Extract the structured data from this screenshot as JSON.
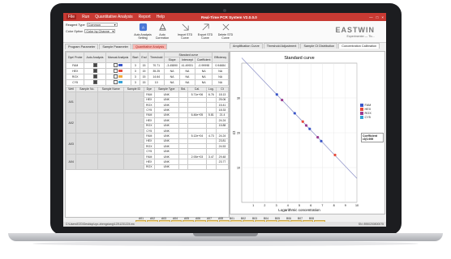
{
  "app": {
    "title": "Real-Time PCR System V2.0.0.0",
    "menu": [
      "File",
      "Run",
      "Quantitative Analysis",
      "Report",
      "Help"
    ],
    "window_controls": [
      "—",
      "□",
      "×"
    ]
  },
  "toolbar": {
    "reagent_type_label": "Reagent Type",
    "reagent_type_value": "Common",
    "color_option_label": "Color Option",
    "color_option_value": "Color by Channe",
    "tools": [
      {
        "label": "Auto Analysis Setting",
        "icon": "auto-analysis-icon"
      },
      {
        "label": "Auto Correction",
        "icon": "auto-correction-icon"
      },
      {
        "label": "Import STD Curve",
        "icon": "import-curve-icon"
      },
      {
        "label": "Export STD Curve",
        "icon": "export-curve-icon"
      },
      {
        "label": "Delete STD Curve",
        "icon": "delete-curve-icon"
      }
    ],
    "brand": "EASTWIN",
    "user": "Experimenter — Tic..."
  },
  "left_tabs": [
    "Program Parameter",
    "Sample Parameter",
    "Quantitative Analysis"
  ],
  "left_tab_active": 2,
  "right_tabs": [
    "Amplification Curve",
    "Threshold Adjustment",
    "Sample Ct Distribution",
    "Concentration Calibration"
  ],
  "right_tab_selected": 3,
  "dye_table": {
    "headers": [
      "Dye/ Probe",
      "Auto Analysis",
      "Manual Analysis",
      "Start",
      "End",
      "Threshold",
      "Slope",
      "Intercept",
      "Coefficient",
      "Efficiency"
    ],
    "group_header": "Standard curve",
    "rows": [
      {
        "dye": "FAM",
        "auto": true,
        "manual": false,
        "start": "3",
        "end": "15",
        "threshold": "70.71",
        "slope": "-3.45890",
        "intercept": "41.49931",
        "coef": "-0.99998",
        "eff": "0.94684",
        "color": "#3a56c9"
      },
      {
        "dye": "HEX",
        "auto": true,
        "manual": false,
        "start": "3",
        "end": "15",
        "threshold": "35.25",
        "slope": "NA",
        "intercept": "NA",
        "coef": "NA",
        "eff": "NA",
        "color": "#e84b3c"
      },
      {
        "dye": "ROX",
        "auto": true,
        "manual": false,
        "start": "3",
        "end": "15",
        "threshold": "14.64",
        "slope": "NA",
        "intercept": "NA",
        "coef": "NA",
        "eff": "NA",
        "color": "#f1a93b"
      },
      {
        "dye": "CY5",
        "auto": true,
        "manual": false,
        "start": "3",
        "end": "15",
        "threshold": "10",
        "slope": "NA",
        "intercept": "NA",
        "coef": "NA",
        "eff": "NA",
        "color": "#36a3d6"
      }
    ]
  },
  "well_table": {
    "headers": [
      "Well",
      "Sample No.",
      "Sample Name",
      "Sample ID",
      "Dye",
      "Sample Type",
      "Std.",
      "Cal.",
      "Log.",
      "Ct"
    ],
    "groups": [
      {
        "well": "A01",
        "rows": [
          {
            "dye": "FAM",
            "type": "UNK",
            "std": "",
            "cal": "5.71e+06",
            "log": "6.76",
            "ct": "18.13"
          },
          {
            "dye": "HEX",
            "type": "UNK",
            "std": "",
            "cal": "",
            "log": "",
            "ct": "25.06"
          },
          {
            "dye": "ROX",
            "type": "UNK",
            "std": "",
            "cal": "",
            "log": "",
            "ct": "15.41"
          },
          {
            "dye": "CY5",
            "type": "UNK",
            "std": "",
            "cal": "",
            "log": "",
            "ct": "18.33"
          }
        ]
      },
      {
        "well": "A02",
        "rows": [
          {
            "dye": "FAM",
            "type": "UNK",
            "std": "",
            "cal": "6.46e+05",
            "log": "5.81",
            "ct": "21.4"
          },
          {
            "dye": "HEX",
            "type": "UNK",
            "std": "",
            "cal": "",
            "log": "",
            "ct": "24.24"
          },
          {
            "dye": "ROX",
            "type": "UNK",
            "std": "",
            "cal": "",
            "log": "",
            "ct": "15.88"
          },
          {
            "dye": "CY5",
            "type": "UNK",
            "std": "",
            "cal": "",
            "log": "",
            "ct": ""
          }
        ]
      },
      {
        "well": "A03",
        "rows": [
          {
            "dye": "FAM",
            "type": "UNK",
            "std": "",
            "cal": "5.12e+04",
            "log": "4.73",
            "ct": "24.24"
          },
          {
            "dye": "HEX",
            "type": "UNK",
            "std": "",
            "cal": "",
            "log": "",
            "ct": "23.81"
          },
          {
            "dye": "ROX",
            "type": "UNK",
            "std": "",
            "cal": "",
            "log": "",
            "ct": "24.53"
          },
          {
            "dye": "CY5",
            "type": "UNK",
            "std": "",
            "cal": "",
            "log": "",
            "ct": ""
          }
        ]
      },
      {
        "well": "A04",
        "rows": [
          {
            "dye": "FAM",
            "type": "UNK",
            "std": "",
            "cal": "2.93e+03",
            "log": "3.47",
            "ct": "29.48"
          },
          {
            "dye": "HEX",
            "type": "UNK",
            "std": "",
            "cal": "",
            "log": "",
            "ct": "23.77"
          },
          {
            "dye": "ROX",
            "type": "UNK",
            "std": "",
            "cal": "",
            "log": "",
            "ct": ""
          }
        ]
      }
    ]
  },
  "chart_data": {
    "type": "scatter",
    "title": "Standard curve",
    "xlabel": "Logarithmic concentration",
    "ylabel": "Ct",
    "xlim": [
      0,
      10
    ],
    "ylim": [
      0,
      40
    ],
    "xticks": [
      1,
      2,
      3,
      4,
      5,
      6,
      7,
      8,
      9,
      10
    ],
    "yticks": [
      10,
      20,
      30
    ],
    "grid": true,
    "legend_placement": "right",
    "fit_line": {
      "x": [
        0,
        10
      ],
      "y": [
        41.5,
        6.9
      ]
    },
    "series": [
      {
        "name": "FAM",
        "color": "#3a56c9",
        "points": [
          [
            3.05,
            31.0
          ],
          [
            4.6,
            25.6
          ],
          [
            5.9,
            21.1
          ],
          [
            6.9,
            17.6
          ]
        ]
      },
      {
        "name": "HEX",
        "color": "#e84b3c",
        "points": [
          [
            5.3,
            23.2
          ],
          [
            8.1,
            13.6
          ]
        ]
      },
      {
        "name": "ROX",
        "color": "#9a3a8f",
        "points": [
          [
            3.5,
            29.4
          ],
          [
            5.6,
            22.1
          ],
          [
            6.6,
            18.7
          ]
        ]
      },
      {
        "name": "CY5",
        "color": "#36a3d6",
        "points": []
      }
    ]
  },
  "coef_label": "Coefficient",
  "coef_value": "r2(0.999",
  "plate": {
    "cols": [
      "A01",
      "A02",
      "A03",
      "A04",
      "A05",
      "A06",
      "A07",
      "A08",
      "B01",
      "B02",
      "B03",
      "B04",
      "B05",
      "B06",
      "B07",
      "B08"
    ],
    "row_label": "A",
    "cell_text": "UNK UNK"
  },
  "status": {
    "path": "C:\\Users\\EZD\\Desktop\\zyc-zhengxiang\\123\\1231224.ew",
    "sn": "SN: 8950200800075"
  }
}
